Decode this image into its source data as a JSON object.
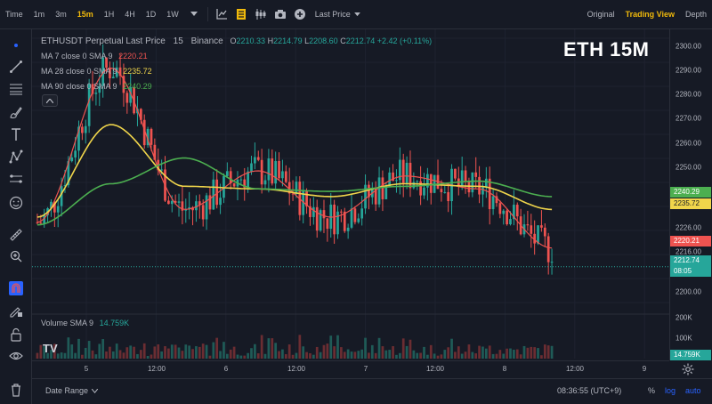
{
  "toolbar": {
    "time_label": "Time",
    "intervals": [
      "1m",
      "3m",
      "15m",
      "1H",
      "4H",
      "1D",
      "1W"
    ],
    "active_interval": "15m",
    "price_type": "Last Price",
    "views": [
      "Original",
      "Trading View",
      "Depth"
    ],
    "active_view": "Trading View",
    "icons": [
      "chevron-down-icon",
      "indicator-icon",
      "chart-type-icon",
      "candle-icon",
      "camera-icon",
      "add-icon"
    ]
  },
  "left_tools": [
    "dot-icon",
    "trend-line-icon",
    "horizontal-lines-icon",
    "brush-icon",
    "text-icon",
    "pattern-icon",
    "measure-icon",
    "emoji-icon",
    "ruler-icon",
    "zoom-icon",
    "magnet-icon",
    "pencil-lock-icon",
    "lock-icon",
    "eye-icon",
    "trash-icon"
  ],
  "legend": {
    "title": "ETHUSDT Perpetual Last Price",
    "interval": "15",
    "exchange": "Binance",
    "o_label": "O",
    "o_value": "2210.33",
    "h_label": "H",
    "h_value": "2214.79",
    "l_label": "L",
    "l_value": "2208.60",
    "c_label": "C",
    "c_value": "2212.74",
    "change": "+2.42 (+0.11%)",
    "ma7_label": "MA 7 close 0 SMA 9",
    "ma7_value": "2220.21",
    "ma28_label": "MA 28 close 0 SMA 9",
    "ma28_value": "2235.72",
    "ma90_label": "MA 90 close 0 SMA 9",
    "ma90_value": "2240.29"
  },
  "watermark": "ETH 15M",
  "volume_legend": {
    "label": "Volume SMA 9",
    "value": "14.759K"
  },
  "tv_logo": "TV",
  "price_scale": {
    "ticks": [
      "2300.00",
      "2290.00",
      "2280.00",
      "2270.00",
      "2260.00",
      "2250.00",
      "2226.00",
      "2216.00",
      "2200.00"
    ],
    "labels": {
      "ma90": "2240.29",
      "ma28": "2235.72",
      "ma7": "2220.21",
      "last": "2212.74",
      "countdown": "08:05"
    },
    "volume_ticks": [
      "200K",
      "100K"
    ],
    "volume_label": "14.759K"
  },
  "time_scale": {
    "ticks": [
      "5",
      "12:00",
      "6",
      "12:00",
      "7",
      "12:00",
      "8",
      "12:00",
      "9"
    ]
  },
  "bottom_bar": {
    "date_range": "Date Range",
    "clock": "08:36:55 (UTC+9)",
    "percent": "%",
    "log": "log",
    "auto": "auto"
  },
  "colors": {
    "up": "#26a69a",
    "down": "#ef5350",
    "ma7": "#ef5350",
    "ma28": "#f0d54b",
    "ma90": "#4caf50",
    "accent": "#f0b90b",
    "background": "#161a25"
  },
  "chart_data": {
    "type": "line",
    "title": "ETHUSDT Perpetual Last Price",
    "ylim": [
      2195,
      2305
    ],
    "x": [
      "5",
      "12:00",
      "6",
      "12:00",
      "7",
      "12:00",
      "8",
      "12:00"
    ],
    "series": [
      {
        "name": "MA 7 close 0 SMA 9",
        "values": [
          2230,
          2290,
          2235,
          2250,
          2232,
          2248,
          2243,
          2220
        ]
      },
      {
        "name": "MA 28 close 0 SMA 9",
        "values": [
          2232,
          2268,
          2244,
          2243,
          2240,
          2245,
          2244,
          2235
        ]
      },
      {
        "name": "MA 90 close 0 SMA 9",
        "values": [
          2229,
          2245,
          2255,
          2243,
          2242,
          2244,
          2246,
          2240
        ]
      }
    ]
  }
}
